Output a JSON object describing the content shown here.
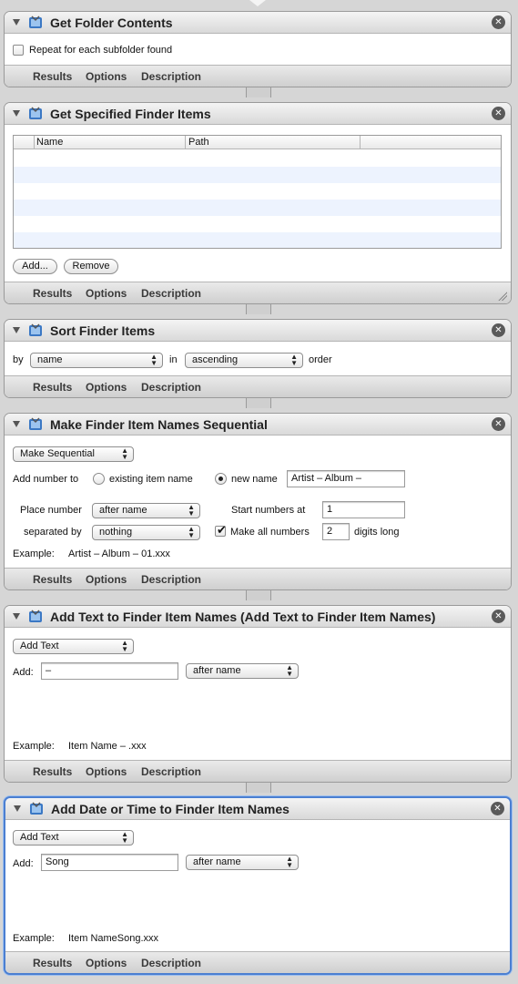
{
  "footer_tabs": [
    "Results",
    "Options",
    "Description"
  ],
  "actions": [
    {
      "title": "Get Folder Contents",
      "repeat_label": "Repeat for each subfolder found"
    },
    {
      "title": "Get Specified Finder Items",
      "columns": [
        "Name",
        "Path"
      ],
      "add_label": "Add...",
      "remove_label": "Remove"
    },
    {
      "title": "Sort Finder Items",
      "by_label": "by",
      "by_value": "name",
      "in_label": "in",
      "in_value": "ascending",
      "order_label": "order"
    },
    {
      "title": "Make Finder Item Names Sequential",
      "mode_value": "Make Sequential",
      "add_number_label": "Add number to",
      "existing_label": "existing item name",
      "new_name_label": "new name",
      "new_name_value": "Artist – Album –",
      "place_label": "Place number",
      "place_value": "after name",
      "start_label": "Start numbers at",
      "start_value": "1",
      "separated_label": "separated by",
      "separated_value": "nothing",
      "make_all_label": "Make all numbers",
      "digits_value": "2",
      "digits_label": "digits long",
      "example_label": "Example:",
      "example_value": "Artist – Album – 01.xxx"
    },
    {
      "title": "Add Text to Finder Item Names (Add Text to Finder Item Names)",
      "mode_value": "Add Text",
      "add_label": "Add:",
      "add_value": "–",
      "position_value": "after name",
      "example_label": "Example:",
      "example_value": "Item Name – .xxx"
    },
    {
      "title": "Add Date or Time to Finder Item Names",
      "mode_value": "Add Text",
      "add_label": "Add:",
      "add_value": "Song",
      "position_value": "after name",
      "example_label": "Example:",
      "example_value": "Item NameSong.xxx"
    }
  ]
}
